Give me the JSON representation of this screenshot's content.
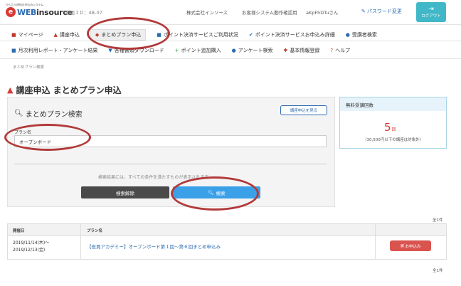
{
  "header": {
    "logo_tagline": "かんたん研修お申込みシステム",
    "logo_mark": "e",
    "logo_text_a": "WEB",
    "logo_text_b": "insource",
    "screen_id": "画面ＩＤ：4B-07",
    "company": "株式会社インソース",
    "system_label": "お客様システム動作確認用",
    "username": "aKpFhDTuさん",
    "password_link": "パスワード変更",
    "logout_label": "ログアウト"
  },
  "nav": {
    "row1": [
      {
        "icon": "home-icon",
        "glyph": "■",
        "label": "マイページ"
      },
      {
        "icon": "graduation-cap-icon",
        "glyph": "▲",
        "label": "講座申込"
      },
      {
        "icon": "bundle-icon",
        "glyph": "◆",
        "label": "まとめプラン申込"
      },
      {
        "icon": "list-icon",
        "glyph": "■",
        "label": "ポイント決済サービスご利用状況"
      },
      {
        "icon": "check-icon",
        "glyph": "✔",
        "label": "ポイント決済サービスお申込み詳細"
      },
      {
        "icon": "search-icon",
        "glyph": "●",
        "label": "受講者検索"
      }
    ],
    "row2": [
      {
        "icon": "report-icon",
        "glyph": "■",
        "label": "月次利用レポート・アンケート結果"
      },
      {
        "icon": "download-icon",
        "glyph": "▼",
        "label": "各種書類ダウンロード"
      },
      {
        "icon": "plus-icon",
        "glyph": "+",
        "label": "ポイント追加購入"
      },
      {
        "icon": "survey-icon",
        "glyph": "●",
        "label": "アンケート検索"
      },
      {
        "icon": "gear-icon",
        "glyph": "✱",
        "label": "基本情報登録"
      },
      {
        "icon": "help-icon",
        "glyph": "?",
        "label": "ヘルプ"
      }
    ]
  },
  "breadcrumb": "まとめプラン検索",
  "page_title": "講座申込 まとめプラン申込",
  "search": {
    "title": "まとめプラン検索",
    "course_button": "講座申込を見る",
    "field_label": "プラン名",
    "field_value": "オープンボード",
    "hint": "検索結果には、すべての条件を満たすものが表示されます",
    "clear_button": "検索解除",
    "search_button": "検索"
  },
  "free_count": {
    "title": "無料受講回数",
    "number": "5",
    "unit": "回",
    "note": "（30,500円以下の講座は対象外）"
  },
  "results": {
    "count": "全1件",
    "columns": [
      "開催日",
      "プラン名"
    ],
    "rows": [
      {
        "date_from": "2019/11/14(木)～",
        "date_to": "2019/12/13(金)",
        "plan_name": "【役員アカデミー】オープンボード第１回～第６回まとめ申込み",
        "apply_button": "お申込み"
      }
    ]
  },
  "colors": {
    "accent_red": "#d83a34",
    "link_blue": "#2b6cb0",
    "search_blue": "#3aa0e8",
    "logout_teal": "#41b8c8",
    "annotation": "#b23a3a"
  }
}
